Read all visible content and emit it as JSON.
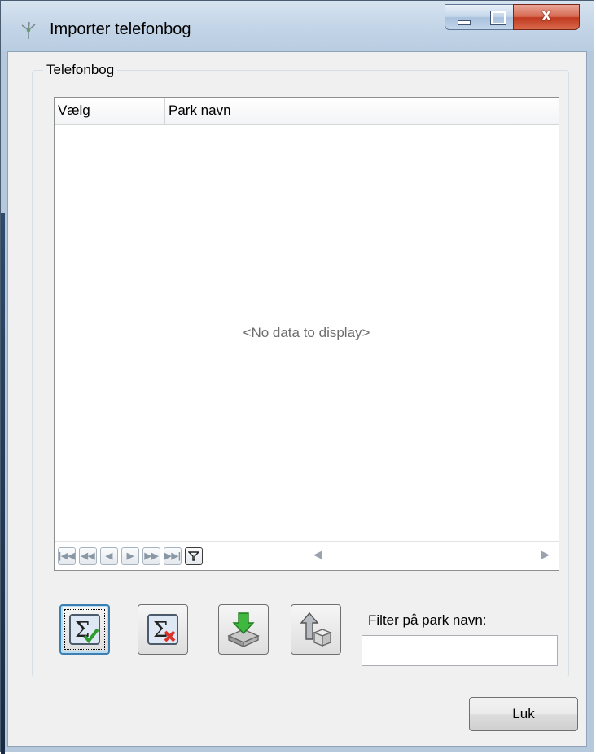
{
  "window": {
    "title": "Importer telefonbog",
    "controls": {
      "minimize_icon": "minimize-icon",
      "maximize_icon": "maximize-icon",
      "close_label": "x"
    }
  },
  "group": {
    "label": "Telefonbog",
    "grid": {
      "columns": [
        "Vælg",
        "Park navn"
      ],
      "rows": [],
      "empty_text": "<No data to display>",
      "navigator": {
        "buttons": [
          "first-icon",
          "prev-page-icon",
          "prev-icon",
          "next-icon",
          "next-page-icon",
          "last-icon",
          "filter-icon"
        ]
      }
    },
    "toolbar": {
      "buttons": [
        "select-all-icon",
        "deselect-all-icon",
        "import-icon",
        "export-icon"
      ]
    },
    "filter": {
      "label": "Filter på park navn:",
      "value": ""
    }
  },
  "footer": {
    "close_label": "Luk"
  },
  "colors": {
    "title_bg": "#c1d3e6",
    "client_bg": "#f0f0f0",
    "close_button": "#c0391f",
    "select_accent": "#3c7fb1"
  }
}
